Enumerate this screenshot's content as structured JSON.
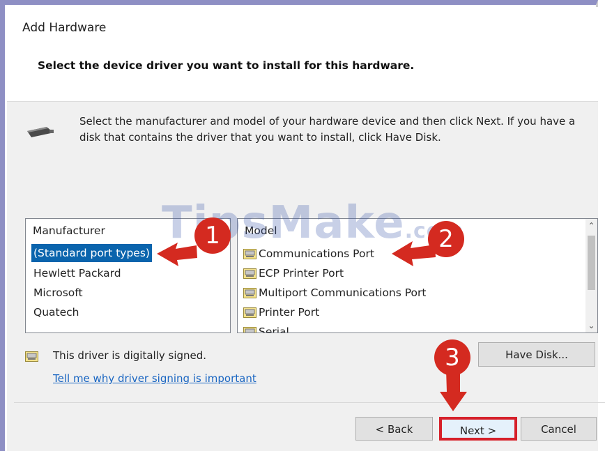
{
  "window": {
    "title": "Add Hardware"
  },
  "header": {
    "page_title": "Select the device driver you want to install for this hardware."
  },
  "instructions": "Select the manufacturer and model of your hardware device and then click Next. If you have a disk that contains the driver that you want to install, click Have Disk.",
  "manufacturer_list": {
    "header": "Manufacturer",
    "items": [
      "(Standard port types)",
      "Hewlett Packard",
      "Microsoft",
      "Quatech"
    ],
    "selected_index": 0
  },
  "model_list": {
    "header": "Model",
    "items": [
      "Communications Port",
      "ECP Printer Port",
      "Multiport Communications Port",
      "Printer Port",
      "Serial"
    ]
  },
  "signing": {
    "status": "This driver is digitally signed.",
    "link": "Tell me why driver signing is important"
  },
  "buttons": {
    "have_disk": "Have Disk...",
    "back": "< Back",
    "next": "Next >",
    "cancel": "Cancel"
  },
  "annotations": {
    "badge1": "1",
    "badge2": "2",
    "badge3": "3"
  },
  "watermark": {
    "text": "TipsMake",
    "suffix": ".com"
  },
  "colors": {
    "selection": "#0a64ad",
    "annotation": "#d42a20",
    "link": "#1a66c2",
    "frame": "#8e8fc4"
  }
}
